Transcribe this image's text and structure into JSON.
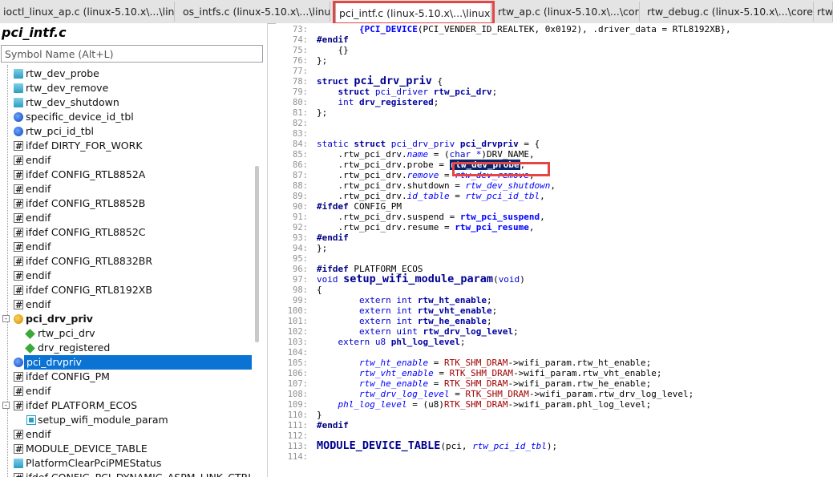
{
  "tabs": [
    {
      "label": "ioctl_linux_ap.c (linux-5.10.x\\...\\linux)",
      "active": false
    },
    {
      "label": "os_intfs.c (linux-5.10.x\\...\\linux)",
      "active": false
    },
    {
      "label": "pci_intf.c (linux-5.10.x\\...\\linux)",
      "active": true,
      "close": "×"
    },
    {
      "label": "rtw_ap.c (linux-5.10.x\\...\\core)",
      "active": false
    },
    {
      "label": "rtw_debug.c (linux-5.10.x\\...\\core)",
      "active": false
    },
    {
      "label": "rtw",
      "active": false
    }
  ],
  "left_panel": {
    "file_title": "pci_intf.c",
    "search_placeholder": "Symbol Name (Alt+L)",
    "items": [
      {
        "label": "rtw_dev_probe",
        "icon": "function-icon",
        "indent": 0
      },
      {
        "label": "rtw_dev_remove",
        "icon": "function-icon",
        "indent": 0
      },
      {
        "label": "rtw_dev_shutdown",
        "icon": "function-icon",
        "indent": 0
      },
      {
        "label": "specific_device_id_tbl",
        "icon": "variable-icon",
        "indent": 0
      },
      {
        "label": "rtw_pci_id_tbl",
        "icon": "variable-icon",
        "indent": 0
      },
      {
        "label": "ifdef DIRTY_FOR_WORK",
        "icon": "ifdef-icon",
        "indent": 0
      },
      {
        "label": "endif",
        "icon": "ifdef-icon",
        "indent": 0
      },
      {
        "label": "ifdef CONFIG_RTL8852A",
        "icon": "ifdef-icon",
        "indent": 0
      },
      {
        "label": "endif",
        "icon": "ifdef-icon",
        "indent": 0
      },
      {
        "label": "ifdef CONFIG_RTL8852B",
        "icon": "ifdef-icon",
        "indent": 0
      },
      {
        "label": "endif",
        "icon": "ifdef-icon",
        "indent": 0
      },
      {
        "label": "ifdef CONFIG_RTL8852C",
        "icon": "ifdef-icon",
        "indent": 0
      },
      {
        "label": "endif",
        "icon": "ifdef-icon",
        "indent": 0
      },
      {
        "label": "ifdef CONFIG_RTL8832BR",
        "icon": "ifdef-icon",
        "indent": 0
      },
      {
        "label": "endif",
        "icon": "ifdef-icon",
        "indent": 0
      },
      {
        "label": "ifdef CONFIG_RTL8192XB",
        "icon": "ifdef-icon",
        "indent": 0
      },
      {
        "label": "endif",
        "icon": "ifdef-icon",
        "indent": 0
      },
      {
        "label": "pci_drv_priv",
        "icon": "struct-icon",
        "indent": 0,
        "expander": "-",
        "bold": true
      },
      {
        "label": "rtw_pci_drv",
        "icon": "member-icon",
        "indent": 1
      },
      {
        "label": "drv_registered",
        "icon": "member-icon",
        "indent": 1
      },
      {
        "label": "pci_drvpriv",
        "icon": "variable-icon",
        "indent": 0,
        "selected": true
      },
      {
        "label": "ifdef CONFIG_PM",
        "icon": "ifdef-icon",
        "indent": 0
      },
      {
        "label": "endif",
        "icon": "ifdef-icon",
        "indent": 0
      },
      {
        "label": "ifdef PLATFORM_ECOS",
        "icon": "ifdef-icon",
        "indent": 0,
        "expander": "-"
      },
      {
        "label": "setup_wifi_module_param",
        "icon": "function-icon",
        "indent": 1
      },
      {
        "label": "endif",
        "icon": "ifdef-icon",
        "indent": 0
      },
      {
        "label": "MODULE_DEVICE_TABLE",
        "icon": "ifdef-icon",
        "indent": 0
      },
      {
        "label": "PlatformClearPciPMEStatus",
        "icon": "function-icon",
        "indent": 0
      },
      {
        "label": "ifdef CONFIG_PCI_DYNAMIC_ASPM_LINK_CTRL",
        "icon": "ifdef-icon",
        "indent": 0
      }
    ]
  },
  "code": {
    "lines": [
      {
        "n": "73:",
        "html": "        <span class='fn'>{PCI_DEVICE</span><span class='dark'>(PCI_VENDER_ID_REALTEK, 0x0192), .driver_data = RTL8192XB},</span>"
      },
      {
        "n": "74:",
        "html": "<span class='pp'>#endif</span>"
      },
      {
        "n": "75:",
        "html": "    <span class='dark'>{}</span>"
      },
      {
        "n": "76:",
        "html": "<span class='dark'>};</span>"
      },
      {
        "n": "77:",
        "html": ""
      },
      {
        "n": "78:",
        "html": "<span class='kw'>struct</span> <span class='bigname'>pci_drv_priv</span> <span class='dark'>{</span>"
      },
      {
        "n": "79:",
        "html": "    <span class='kw'>struct</span> <span class='ty'>pci_driver</span> <span class='kw'>rtw_pci_drv</span><span class='dark'>;</span>"
      },
      {
        "n": "80:",
        "html": "    <span class='ty'>int</span> <span class='kw'>drv_registered</span><span class='dark'>;</span>"
      },
      {
        "n": "81:",
        "html": "<span class='dark'>};</span>"
      },
      {
        "n": "82:",
        "html": ""
      },
      {
        "n": "83:",
        "html": ""
      },
      {
        "n": "84:",
        "html": "<span class='ty'>static</span> <span class='kw'>struct</span> <span class='ty'>pci_drv_priv</span> <span class='kw'>pci_drvpriv</span> <span class='dark'>= {</span>"
      },
      {
        "n": "85:",
        "html": "    <span class='dark'>.rtw_pci_drv.</span><span class='mem'>name</span> <span class='dark'>= (</span><span class='ty'>char *</span><span class='dark'>)DRV_NAME,</span>"
      },
      {
        "n": "86:",
        "html": "    <span class='dark'>.rtw_pci_drv.probe = </span><span class='sel-word'>rtw_dev_probe</span><span class='dark'>,</span>"
      },
      {
        "n": "87:",
        "html": "    <span class='dark'>.rtw_pci_drv.</span><span class='mem'>remove</span> <span class='dark'>= </span><span class='mem'>rtw_dev_remove</span><span class='dark'>,</span>"
      },
      {
        "n": "88:",
        "html": "    <span class='dark'>.rtw_pci_drv.shutdown = </span><span class='mem'>rtw_dev_shutdown</span><span class='dark'>,</span>"
      },
      {
        "n": "89:",
        "html": "    <span class='dark'>.rtw_pci_drv.</span><span class='mem'>id_table</span> <span class='dark'>= </span><span class='mem'>rtw_pci_id_tbl</span><span class='dark'>,</span>"
      },
      {
        "n": "90:",
        "html": "<span class='pp'>#ifdef</span> <span class='dark'>CONFIG_PM</span>"
      },
      {
        "n": "91:",
        "html": "    <span class='dark'>.rtw_pci_drv.suspend = </span><span class='fn'>rtw_pci_suspend</span><span class='dark'>,</span>"
      },
      {
        "n": "92:",
        "html": "    <span class='dark'>.rtw_pci_drv.resume = </span><span class='fn'>rtw_pci_resume</span><span class='dark'>,</span>"
      },
      {
        "n": "93:",
        "html": "<span class='pp'>#endif</span>"
      },
      {
        "n": "94:",
        "html": "<span class='dark'>};</span>"
      },
      {
        "n": "95:",
        "html": ""
      },
      {
        "n": "96:",
        "html": "<span class='pp'>#ifdef</span> <span class='dark'>PLATFORM_ECOS</span>"
      },
      {
        "n": "97:",
        "html": "<span class='ty'>void</span> <span class='bigname'>setup_wifi_module_param</span><span class='dark'>(</span><span class='ty'>void</span><span class='dark'>)</span>"
      },
      {
        "n": "98:",
        "html": "<span class='dark'>{</span>"
      },
      {
        "n": "99:",
        "html": "        <span class='ty'>extern</span> <span class='ty'>int</span> <span class='kw'>rtw_ht_enable</span><span class='dark'>;</span>"
      },
      {
        "n": "100:",
        "html": "        <span class='ty'>extern</span> <span class='ty'>int</span> <span class='kw'>rtw_vht_enable</span><span class='dark'>;</span>"
      },
      {
        "n": "101:",
        "html": "        <span class='ty'>extern</span> <span class='ty'>int</span> <span class='kw'>rtw_he_enable</span><span class='dark'>;</span>"
      },
      {
        "n": "102:",
        "html": "        <span class='ty'>extern</span> <span class='ty'>uint</span> <span class='kw'>rtw_drv_log_level</span><span class='dark'>;</span>"
      },
      {
        "n": "103:",
        "html": "    <span class='ty'>extern</span> <span class='ty'>u8</span> <span class='kw'>phl_log_level</span><span class='dark'>;</span>"
      },
      {
        "n": "104:",
        "html": ""
      },
      {
        "n": "105:",
        "html": "        <span class='mem'>rtw_ht_enable</span> <span class='dark'>= </span><span class='str'>RTK_SHM_DRAM</span><span class='dark'>-&gt;wifi_param.rtw_ht_enable;</span>"
      },
      {
        "n": "106:",
        "html": "        <span class='mem'>rtw_vht_enable</span> <span class='dark'>= </span><span class='str'>RTK_SHM_DRAM</span><span class='dark'>-&gt;wifi_param.rtw_vht_enable;</span>"
      },
      {
        "n": "107:",
        "html": "        <span class='mem'>rtw_he_enable</span> <span class='dark'>= </span><span class='str'>RTK_SHM_DRAM</span><span class='dark'>-&gt;wifi_param.rtw_he_enable;</span>"
      },
      {
        "n": "108:",
        "html": "        <span class='mem'>rtw_drv_log_level</span> <span class='dark'>= </span><span class='str'>RTK_SHM_DRAM</span><span class='dark'>-&gt;wifi_param.rtw_drv_log_level;</span>"
      },
      {
        "n": "109:",
        "html": "    <span class='mem'>phl_log_level</span> <span class='dark'>= (u8)</span><span class='str'>RTK_SHM_DRAM</span><span class='dark'>-&gt;wifi_param.phl_log_level;</span>"
      },
      {
        "n": "110:",
        "html": "<span class='dark'>}</span>"
      },
      {
        "n": "111:",
        "html": "<span class='pp'>#endif</span>"
      },
      {
        "n": "112:",
        "html": ""
      },
      {
        "n": "113:",
        "html": "<span class='bigname'>MODULE_DEVICE_TABLE</span><span class='dark'>(pci, </span><span class='mem'>rtw_pci_id_tbl</span><span class='dark'>);</span>"
      },
      {
        "n": "114:",
        "html": ""
      }
    ]
  },
  "colors": {
    "highlight_box": "#e54545",
    "selection_blue": "#0a73d4",
    "word_selection": "#0a246a"
  }
}
